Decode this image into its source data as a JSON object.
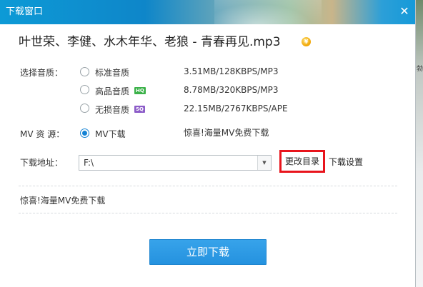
{
  "window": {
    "title": "下载窗口",
    "close_glyph": "✕"
  },
  "song": {
    "title": "叶世荣、李健、水木年华、老狼 - 青春再见.mp3",
    "coin_glyph": "¥"
  },
  "quality": {
    "label": "选择音质：",
    "options": [
      {
        "label": "标准音质",
        "badge": "",
        "spec": "3.51MB/128KBPS/MP3",
        "checked": false
      },
      {
        "label": "高品音质",
        "badge": "HQ",
        "spec": "8.78MB/320KBPS/MP3",
        "checked": false
      },
      {
        "label": "无损音质",
        "badge": "SQ",
        "spec": "22.15MB/2767KBPS/APE",
        "checked": false
      }
    ]
  },
  "mv": {
    "label": "MV 资 源：",
    "option_label": "MV下载",
    "checked": true,
    "promo": "惊喜!海量MV免费下载"
  },
  "path": {
    "label": "下载地址：",
    "value": "F:\\",
    "arrow_glyph": "▼",
    "change_button": "更改目录",
    "settings_link": "下载设置"
  },
  "promo2": "惊喜!海量MV免费下载",
  "download_button": "立即下载",
  "colors": {
    "accent": "#2592df",
    "highlight_border": "#e8141c",
    "hq_badge": "#3cb24a",
    "sq_badge": "#8c5cc8"
  }
}
